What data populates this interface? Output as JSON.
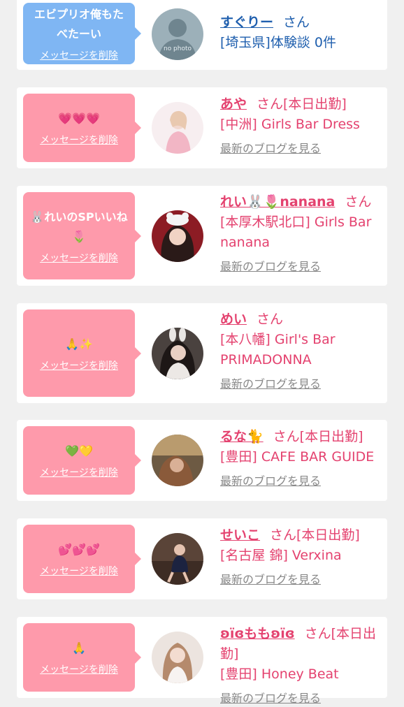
{
  "delete_label": "メッセージを削除",
  "blog_label": "最新のブログを見る",
  "colors": {
    "pink_bubble": "#fe9aab",
    "blue_bubble": "#7fb6f3",
    "name_pink": "#e4426f",
    "name_blue": "#1f5fae",
    "blog_gray": "#888888"
  },
  "items": [
    {
      "message": "エビプリオ俺もたべたーい",
      "name": "すぐりー",
      "suffix": "さん",
      "shop": "[埼玉県]体験談 0件",
      "blog": "",
      "avatar_text": "no photo",
      "avatar_icon": "person-silhouette-icon"
    },
    {
      "message": "💗💗💗",
      "name": "あや",
      "suffix": "さん[本日出勤]",
      "shop": "[中洲] Girls Bar Dress",
      "blog": "最新のブログを見る"
    },
    {
      "message": "🐰れいのSPいいね🌷",
      "name": "れい🐰🌷nanana",
      "suffix": "さん",
      "shop": "[本厚木駅北口] Girls Bar nanana",
      "blog": "最新のブログを見る"
    },
    {
      "message": "🙏✨",
      "name": "めい",
      "suffix": "さん",
      "shop": "[本八幡] Girl's Bar PRIMADONNA",
      "blog": "最新のブログを見る"
    },
    {
      "message": "💚💛",
      "name": "るな🐈",
      "suffix": "さん[本日出勤]",
      "shop": "[豊田] CAFE BAR GUIDE",
      "blog": "最新のブログを見る"
    },
    {
      "message": "💕💕💕",
      "name": "せいこ",
      "suffix": "さん[本日出勤]",
      "shop": "[名古屋 錦] Verxina",
      "blog": "最新のブログを見る"
    },
    {
      "message": "🙏",
      "name": "ʚïɞももʚïɞ",
      "suffix": "さん[本日出勤]",
      "shop": "[豊田] Honey Beat",
      "blog": "最新のブログを見る"
    }
  ]
}
